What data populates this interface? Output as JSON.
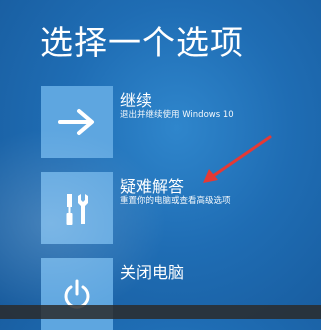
{
  "title": "选择一个选项",
  "options": [
    {
      "label": "继续",
      "description": "退出并继续使用 Windows 10",
      "icon": "arrow-right-icon"
    },
    {
      "label": "疑难解答",
      "description": "重置你的电脑或查看高级选项",
      "icon": "tools-icon"
    },
    {
      "label": "关闭电脑",
      "description": "",
      "icon": "power-icon"
    }
  ],
  "colors": {
    "background": "#1f6db4",
    "tile": "#5ea6e0",
    "annotation_arrow": "#e53935"
  }
}
